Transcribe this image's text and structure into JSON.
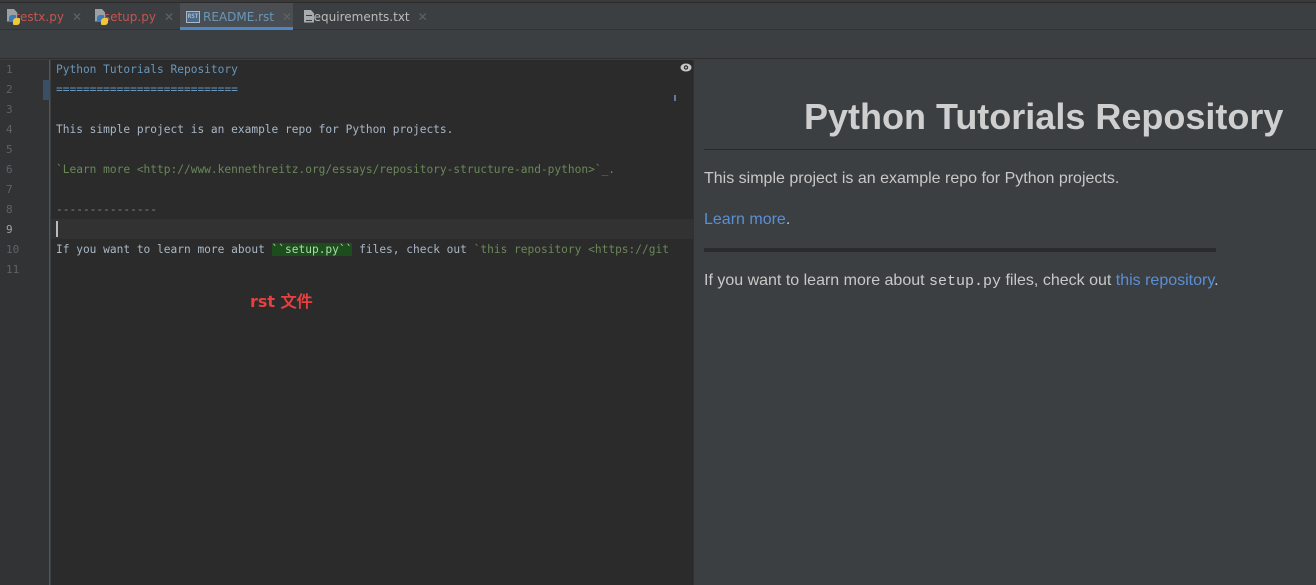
{
  "tabs": [
    {
      "label": "testx.py",
      "icon": "python-file-icon",
      "color": "#c75450",
      "active": false
    },
    {
      "label": "setup.py",
      "icon": "python-file-icon",
      "color": "#c75450",
      "active": false
    },
    {
      "label": "README.rst",
      "icon": "rst-file-icon",
      "icon_text": "RST",
      "color": "#6897bb",
      "active": true
    },
    {
      "label": "requirements.txt",
      "icon": "text-file-icon",
      "color": "#bbbbbb",
      "active": false
    }
  ],
  "tab_close_glyph": "✕",
  "editor": {
    "line_numbers": [
      "1",
      "2",
      "3",
      "4",
      "5",
      "6",
      "7",
      "8",
      "9",
      "10",
      "11"
    ],
    "current_line": "9",
    "lines": {
      "l1": "Python Tutorials Repository",
      "l2": "===========================",
      "l4": "This simple project is an example repo for Python projects.",
      "l6": "`Learn more <http://www.kennethreitz.org/essays/repository-structure-and-python>`_.",
      "l8": "---------------",
      "l10_pre": "If you want to learn more about ",
      "l10_lit": "``setup.py``",
      "l10_mid": " files, check out ",
      "l10_link": "`this repository <https://git"
    },
    "annotation": "rst 文件"
  },
  "preview": {
    "title": "Python Tutorials Repository",
    "para1": "This simple project is an example repo for Python projects.",
    "learn_more_link": "Learn more",
    "learn_more_suffix": ".",
    "para3_pre": "If you want to learn more about ",
    "para3_code": "setup.py",
    "para3_mid": " files, check out ",
    "para3_link": "this repository",
    "para3_suffix": "."
  },
  "colors": {
    "accent": "#4a88c7",
    "link": "#5a8fd6",
    "annotation": "#e84040"
  }
}
